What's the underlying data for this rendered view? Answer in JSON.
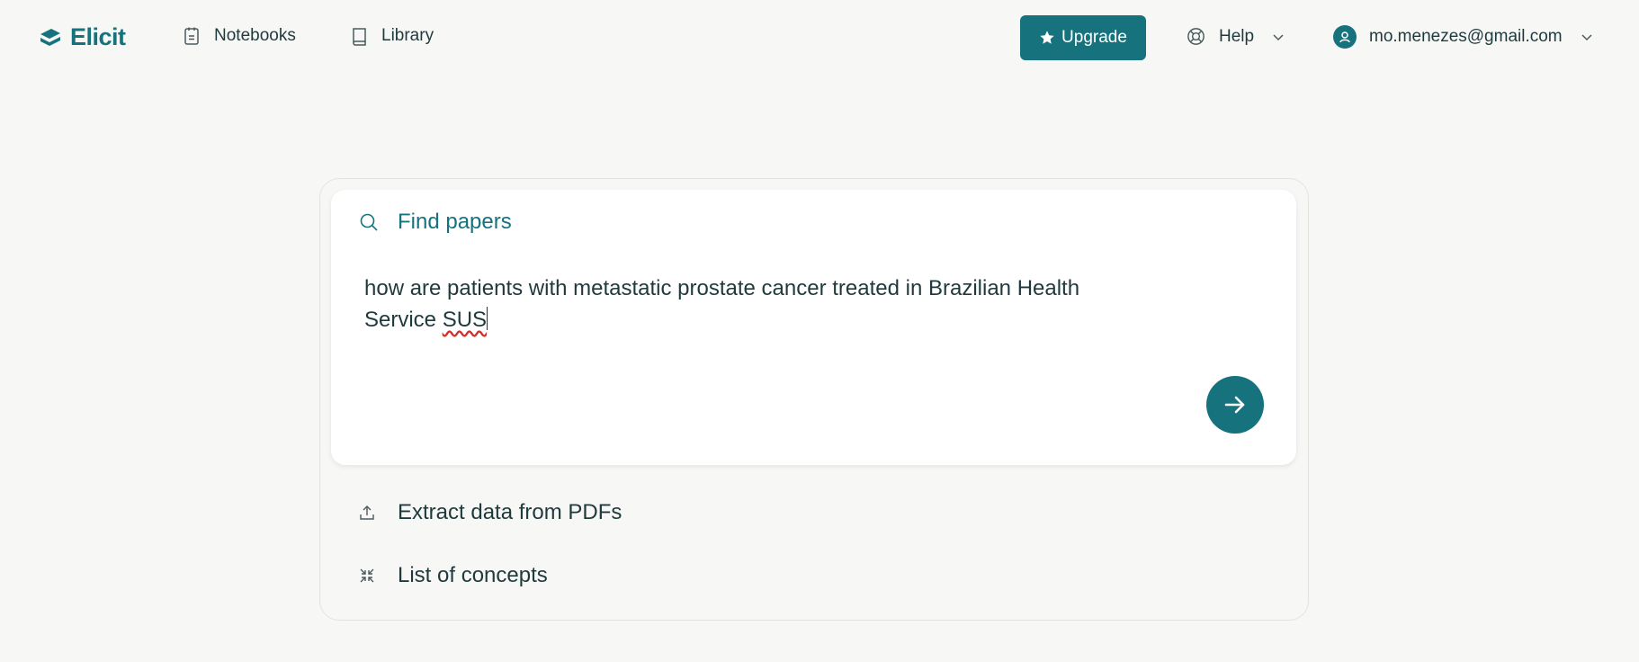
{
  "nav": {
    "logo_text": "Elicit",
    "notebooks_label": "Notebooks",
    "library_label": "Library",
    "upgrade_label": "Upgrade",
    "help_label": "Help",
    "account_email": "mo.menezes@gmail.com"
  },
  "search": {
    "mode_label": "Find papers",
    "query_line1": "how are patients with metastatic prostate cancer treated in Brazilian Health",
    "query_line2_prefix": "Service ",
    "query_line2_flagged": "SUS"
  },
  "options": {
    "extract_label": "Extract data from PDFs",
    "concepts_label": "List of concepts"
  },
  "colors": {
    "accent": "#16737e",
    "background": "#f7f7f5",
    "text": "#1f3a3d",
    "spellcheck": "#d32f2f"
  }
}
